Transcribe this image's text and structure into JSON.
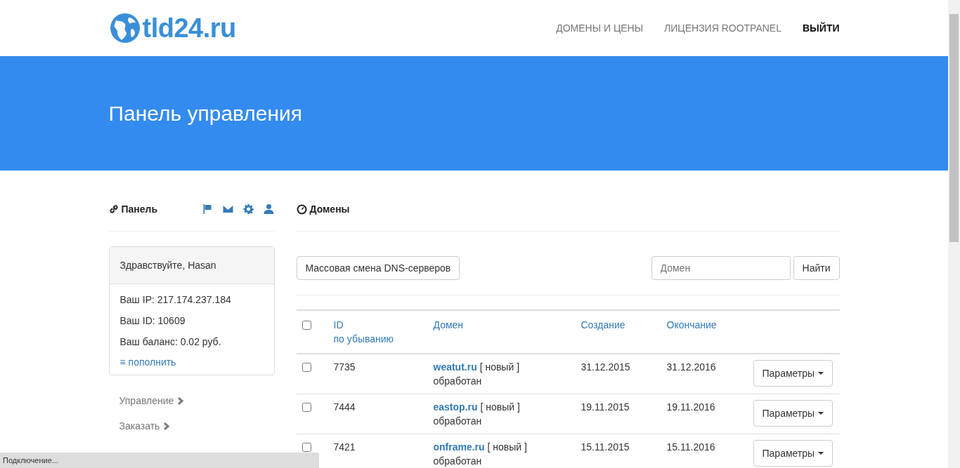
{
  "header": {
    "logo": "tld24.ru",
    "nav": [
      {
        "label": "ДОМЕНЫ И ЦЕНЫ",
        "kind": "link"
      },
      {
        "label": "ЛИЦЕНЗИЯ ROOTPANEL",
        "kind": "link"
      },
      {
        "label": "ВЫЙТИ",
        "kind": "action"
      }
    ]
  },
  "banner": {
    "title": "Панель управления"
  },
  "sidebar": {
    "title": "Панель",
    "card": {
      "greeting": "Здравствуйте, Hasan",
      "lines": [
        "Ваш IP: 217.174.237.184",
        "Ваш ID: 10609",
        "Ваш баланс: 0.02 руб."
      ],
      "link": "≡ пополнить"
    },
    "menu": [
      "Управление",
      "Заказать"
    ]
  },
  "main": {
    "title": "Домены",
    "mass_button": "Массовая смена DNS-серверов",
    "search": {
      "placeholder": "Домен",
      "button": "Найти"
    },
    "table": {
      "select_all": {
        "checked": false
      },
      "columns": [
        {
          "label": "ID",
          "sub": "по убыванию"
        },
        {
          "label": "Домен"
        },
        {
          "label": "Создание"
        },
        {
          "label": "Окончание"
        }
      ],
      "rows": [
        {
          "checked": false,
          "id": "7735",
          "domain": "weatut.ru",
          "tag": "[ новый ]",
          "state": "обработан",
          "created": "31.12.2015",
          "expires": "31.12.2016",
          "action": "Параметры"
        },
        {
          "checked": false,
          "id": "7444",
          "domain": "eastop.ru",
          "tag": "[ новый ]",
          "state": "обработан",
          "created": "19.11.2015",
          "expires": "19.11.2016",
          "action": "Параметры"
        },
        {
          "checked": false,
          "id": "7421",
          "domain": "onframe.ru",
          "tag": "[ новый ]",
          "state": "обработан",
          "created": "15.11.2015",
          "expires": "15.11.2016",
          "action": "Параметры"
        }
      ]
    }
  },
  "status_bar": "Подключение..."
}
